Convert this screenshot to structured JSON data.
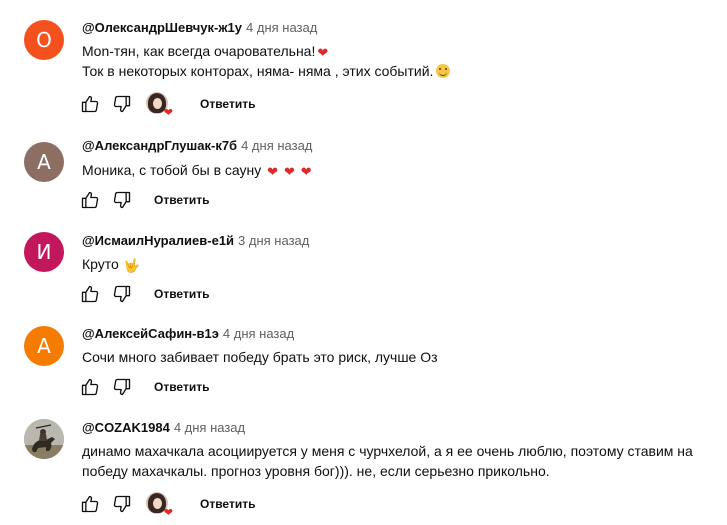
{
  "comments": [
    {
      "author": "@ОлександрШевчук-ж1у",
      "time": "4 дня назад",
      "avatar_letter": "О",
      "avatar_color": "#f4511e",
      "lines": [
        "Mon-тян, как всегда очаровательна!",
        "Ток в некоторых конторах, няма- няма , этих событий."
      ],
      "reply_label": "Ответить",
      "creator_heart": true
    },
    {
      "author": "@АлександрГлушак-к7б",
      "time": "4 дня назад",
      "avatar_letter": "А",
      "avatar_color": "#8d6e63",
      "lines": [
        "Моника, с тобой бы в сауну"
      ],
      "reply_label": "Ответить",
      "creator_heart": false
    },
    {
      "author": "@ИсмаилНуралиев-е1й",
      "time": "3 дня назад",
      "avatar_letter": "И",
      "avatar_color": "#c2185b",
      "lines": [
        "Круто"
      ],
      "reply_label": "Ответить",
      "creator_heart": false
    },
    {
      "author": "@АлексейСафин-в1э",
      "time": "4 дня назад",
      "avatar_letter": "А",
      "avatar_color": "#f57c00",
      "lines": [
        "Сочи много забивает победу брать это риск, лучше Оз"
      ],
      "reply_label": "Ответить",
      "creator_heart": false
    },
    {
      "author": "@COZAK1984",
      "time": "4 дня назад",
      "lines": [
        "динамо махачкала асоциируется у меня с чурчхелой, а я ее очень люблю, поэтому ставим на победу махачкалы. прогноз уровня бог))).  не, если серьезно прикольно."
      ],
      "reply_label": "Ответить",
      "creator_heart": true
    }
  ]
}
